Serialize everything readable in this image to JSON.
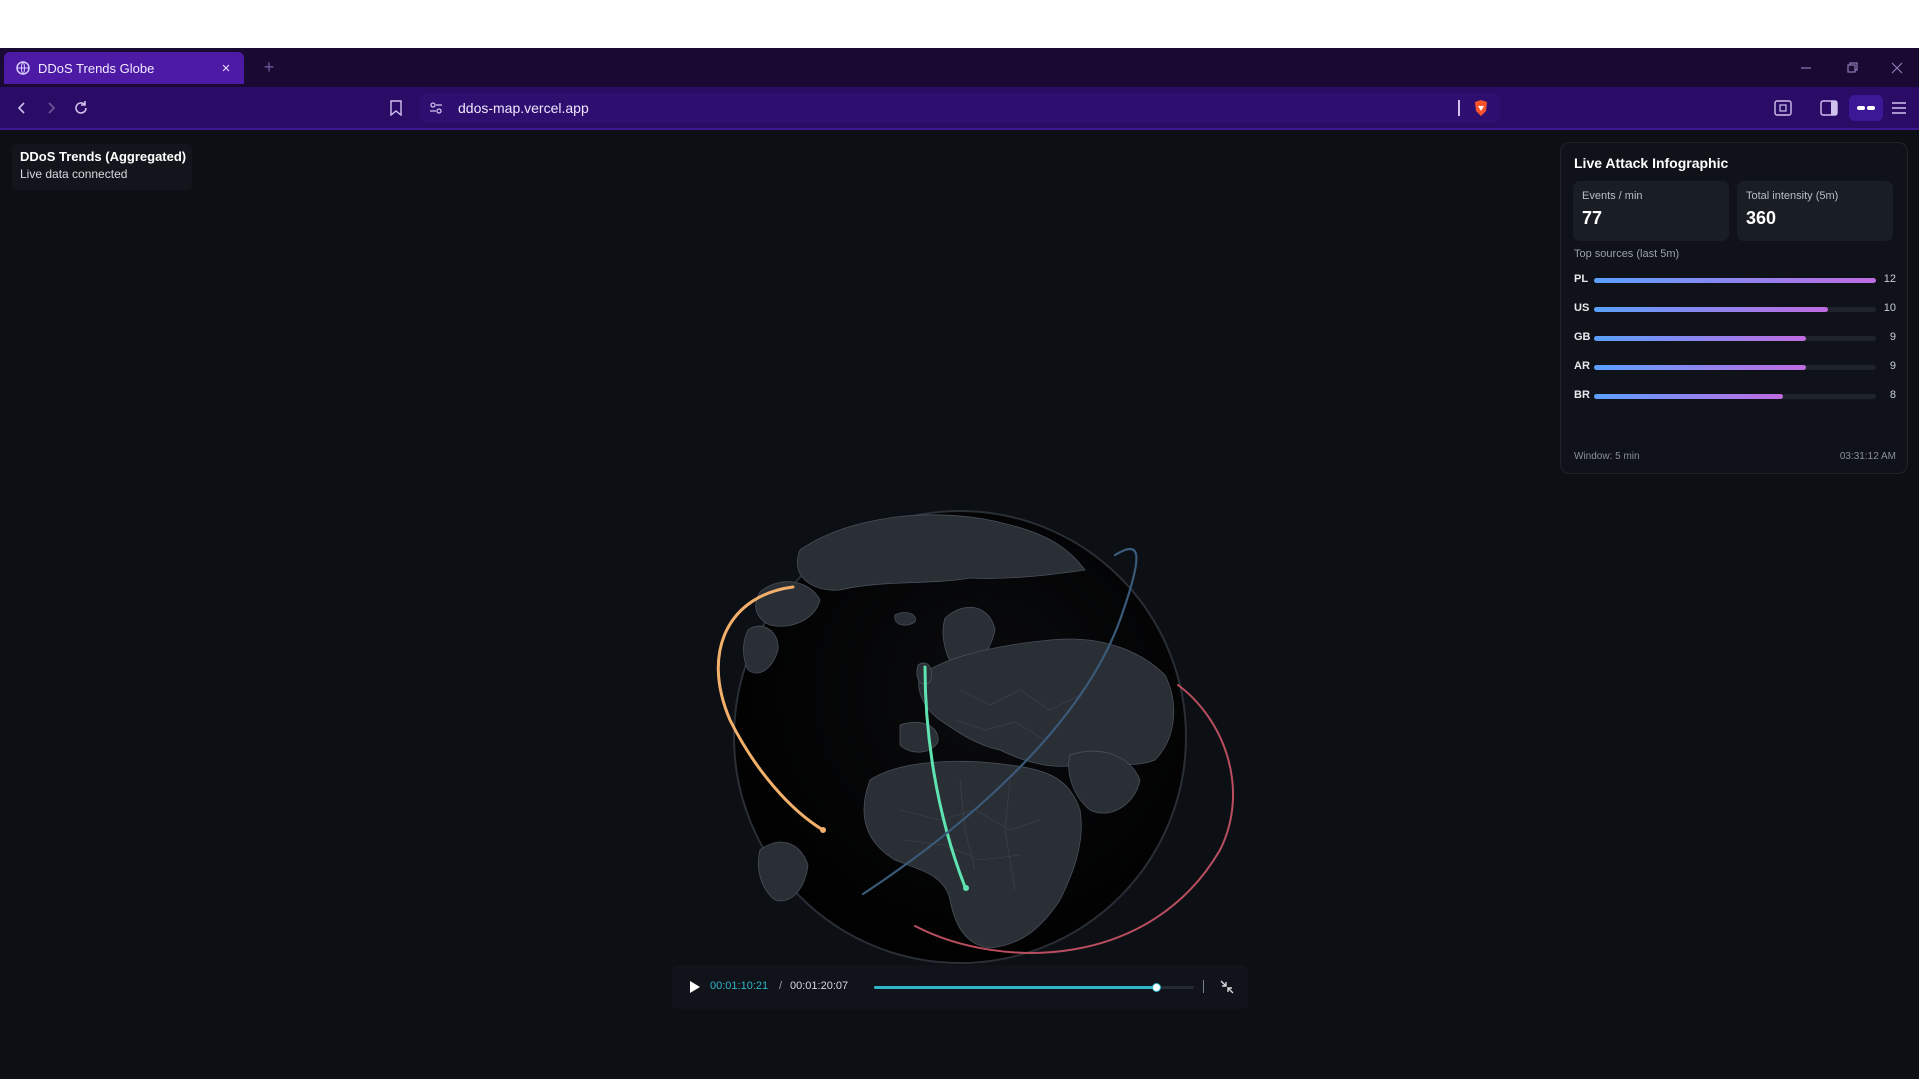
{
  "browser": {
    "tab_title": "DDoS Trends Globe",
    "tab_close": "×",
    "new_tab": "+",
    "url": "ddos-map.vercel.app"
  },
  "status": {
    "heading": "DDoS Trends (Aggregated)",
    "subtext": "Live data connected"
  },
  "panel": {
    "title": "Live Attack Infographic",
    "events_label": "Events / min",
    "events_value": "77",
    "intensity_label": "Total intensity (5m)",
    "intensity_value": "360",
    "sources_heading": "Top sources (last 5m)",
    "sources": [
      {
        "code": "PL",
        "count": "12",
        "fraction": 1.0
      },
      {
        "code": "US",
        "count": "10",
        "fraction": 0.83
      },
      {
        "code": "GB",
        "count": "9",
        "fraction": 0.75
      },
      {
        "code": "AR",
        "count": "9",
        "fraction": 0.75
      },
      {
        "code": "BR",
        "count": "8",
        "fraction": 0.67
      }
    ],
    "window_label": "Window: 5 min",
    "time": "03:31:12 AM"
  },
  "player": {
    "current_time": "00:01:10:21",
    "separator": "/",
    "duration": "00:01:20:07",
    "progress": 0.88
  },
  "colors": {
    "accent": "#2fb6c8",
    "arc_orange": "#f3b06b",
    "arc_green": "#5fe3b0",
    "arc_red": "#b94f5e",
    "arc_blue": "#3a5a7a",
    "tab_active": "#4d1aa6",
    "toolbar": "#2a0b66"
  },
  "icons": [
    "globe-favicon-icon",
    "back-icon",
    "forward-icon",
    "reload-icon",
    "bookmark-icon",
    "site-settings-icon",
    "brave-shield-icon",
    "screenshot-icon",
    "sidebar-icon",
    "wallet-icon",
    "menu-icon",
    "play-icon",
    "exit-fullscreen-icon"
  ]
}
